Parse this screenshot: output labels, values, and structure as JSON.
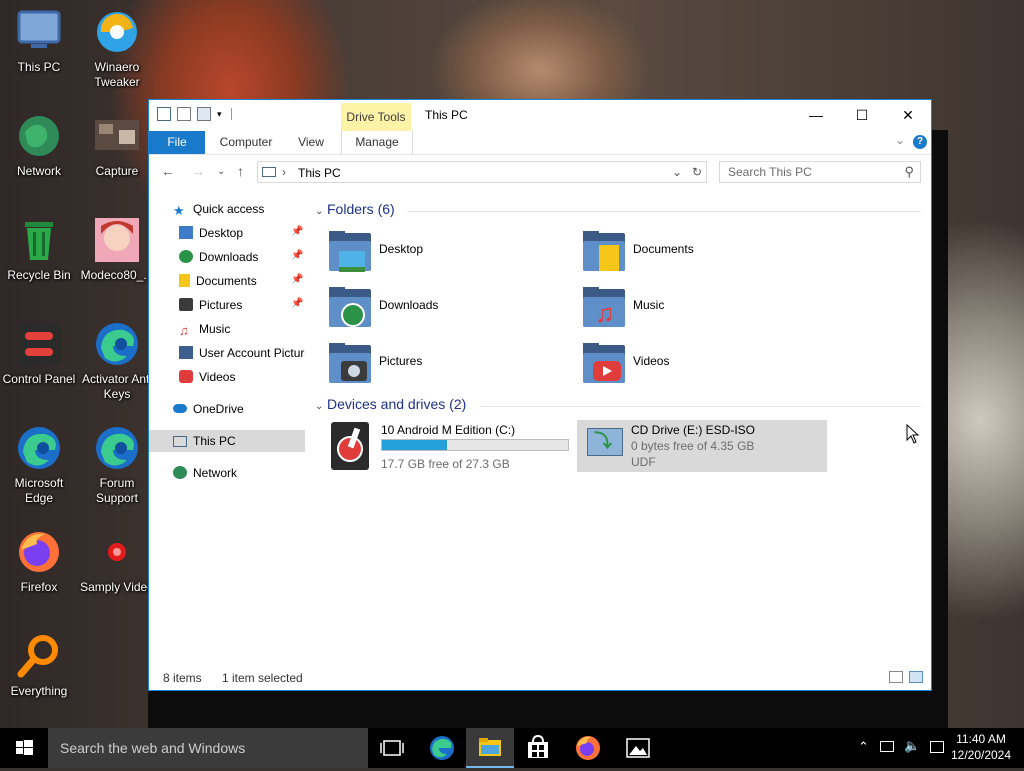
{
  "desktop": {
    "icons": [
      {
        "label": "This PC"
      },
      {
        "label": "Winaero Tweaker"
      },
      {
        "label": "Network"
      },
      {
        "label": "Capture"
      },
      {
        "label": "Recycle Bin"
      },
      {
        "label": "Modeco80_..."
      },
      {
        "label": "Control Panel"
      },
      {
        "label": "Activator Anti Keys"
      },
      {
        "label": "Microsoft Edge"
      },
      {
        "label": "Forum Support"
      },
      {
        "label": "Firefox"
      },
      {
        "label": "Samply Video"
      },
      {
        "label": "Everything"
      }
    ]
  },
  "window": {
    "title": "This PC",
    "context_tab_group": "Drive Tools",
    "ribbon_tabs": [
      "File",
      "Computer",
      "View",
      "Manage"
    ],
    "address": {
      "crumb": "This PC"
    },
    "search": {
      "placeholder": "Search This PC"
    },
    "help_label": "?",
    "nav": {
      "quick_access": "Quick access",
      "items": [
        "Desktop",
        "Downloads",
        "Documents",
        "Pictures",
        "Music",
        "User Account Pictures",
        "Videos"
      ],
      "onedrive": "OneDrive",
      "this_pc": "This PC",
      "network": "Network"
    },
    "folders_header": "Folders (6)",
    "folders": [
      "Desktop",
      "Documents",
      "Downloads",
      "Music",
      "Pictures",
      "Videos"
    ],
    "drives_header": "Devices and drives (2)",
    "drives": [
      {
        "name": "10 Android M Edition (C:)",
        "free": "17.7 GB free of 27.3 GB",
        "used_fraction": 0.35
      },
      {
        "name": "CD Drive (E:) ESD-ISO",
        "free": "0 bytes free of 4.35 GB",
        "fs": "UDF"
      }
    ],
    "status": {
      "items": "8 items",
      "selected": "1 item selected"
    }
  },
  "taskbar": {
    "search_placeholder": "Search the web and Windows",
    "time": "11:40 AM",
    "date": "12/20/2024"
  },
  "colors": {
    "accent": "#1979ca",
    "drive_tools": "#fdf3a6",
    "selection": "#d9d9d9",
    "group_header": "#1e3287"
  }
}
